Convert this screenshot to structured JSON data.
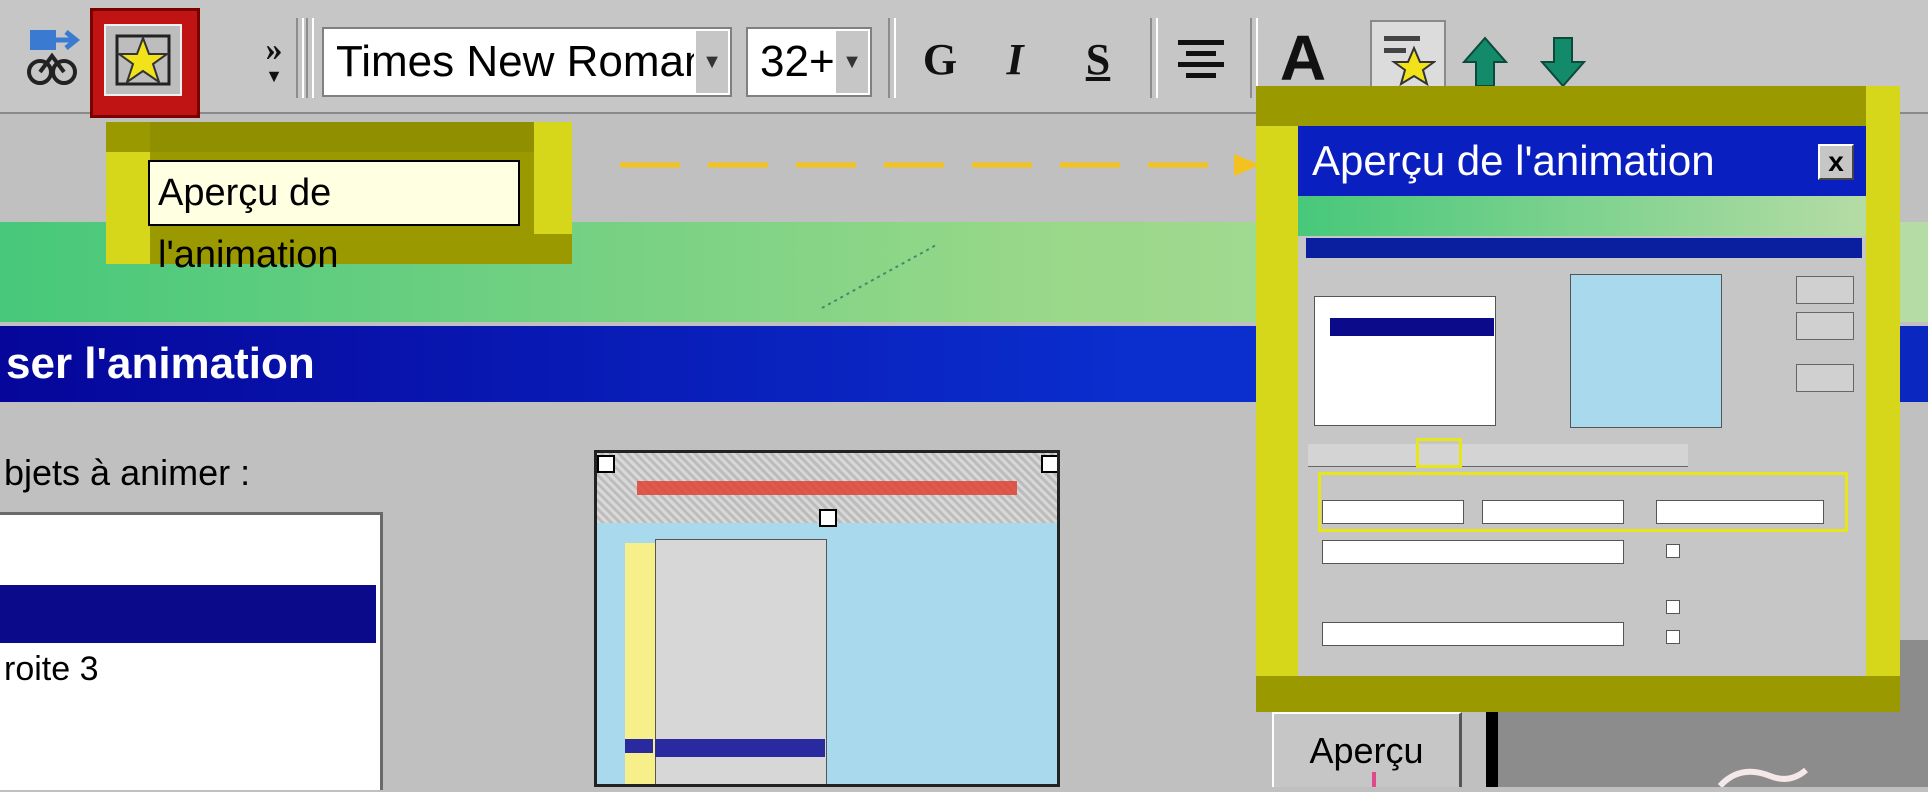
{
  "toolbar": {
    "overflow_label": "»",
    "font_name": "Times New Roman",
    "font_size": "32+",
    "bold_label": "G",
    "italic_label": "I",
    "strike_label": "S",
    "grow_font_label": "A"
  },
  "tooltip": {
    "label": "Aperçu de l'animation"
  },
  "bg_dialog": {
    "title": "ser l'animation",
    "objects_label": "bjets à animer :",
    "list_item_3": "roite 3",
    "preview_button": "Aperçu"
  },
  "zoom_dialog": {
    "title": "Aperçu de l'animation",
    "close_label": "x"
  },
  "colors": {
    "callout_yellow": "#d9d900",
    "callout_olive": "#9a9900",
    "highlight_red": "#cc0000",
    "title_blue": "#0a1fc0",
    "selection_navy": "#0a0a8a"
  }
}
